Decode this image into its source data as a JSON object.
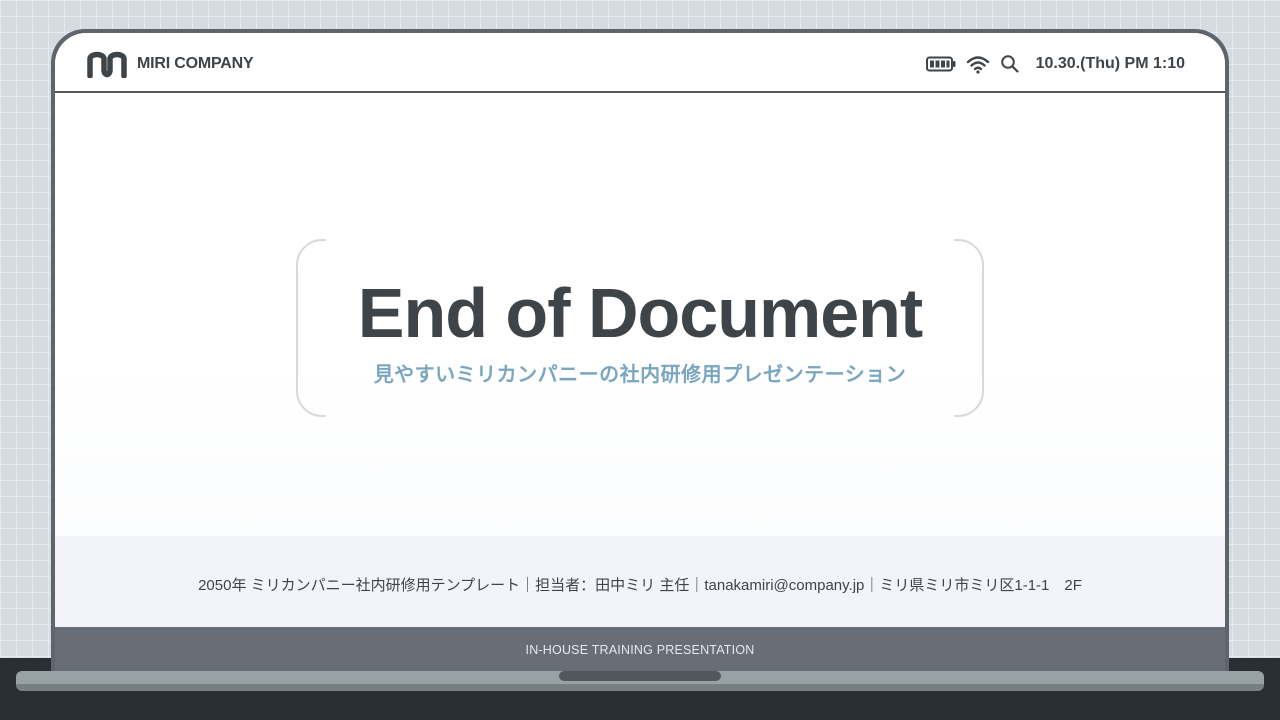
{
  "header": {
    "company_name": "MIRI COMPANY",
    "datetime": "10.30.(Thu) PM 1:10"
  },
  "icons": [
    "logo-icon",
    "battery-icon",
    "wifi-icon",
    "search-icon"
  ],
  "slide": {
    "title": "End of Document",
    "subtitle": "見やすいミリカンパニーの社内研修用プレゼンテーション"
  },
  "footer": {
    "info": "2050年 ミリカンパニー社内研修用テンプレート｜担当者：田中ミリ 主任｜tanakamiri@company.jp｜ミリ県ミリ市ミリ区1-1-1　2F",
    "label": "IN-HOUSE TRAINING PRESENTATION"
  },
  "colors": {
    "accent": "#7aa6c0",
    "text": "#3f4449",
    "frame": "#5f656c"
  }
}
